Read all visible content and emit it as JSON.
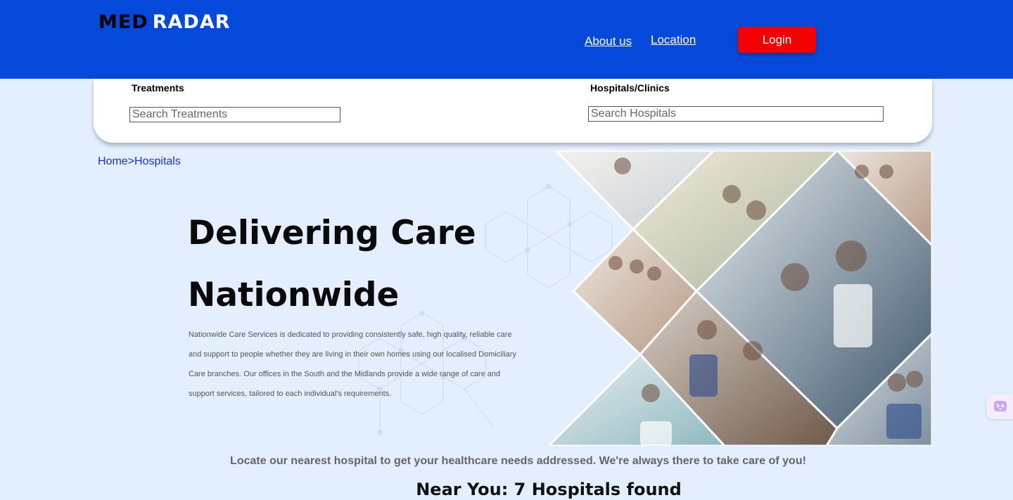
{
  "header": {
    "logo_left": "MED",
    "logo_right": "RADAR",
    "nav": {
      "about": "About us",
      "location": "Location"
    },
    "login_label": "Login"
  },
  "search": {
    "treatments_label": "Treatments",
    "treatments_placeholder": "Search Treatments",
    "hospitals_label": "Hospitals/Clinics",
    "hospitals_placeholder": "Search Hospitals"
  },
  "breadcrumb": {
    "home": "Home",
    "separator": ">",
    "current": "Hospitals"
  },
  "hero": {
    "title_line1": "Delivering Care",
    "title_line2": "Nationwide",
    "description": "Nationwide Care Services is dedicated to providing consistently safe, high quality, reliable care and support to people whether they are living in their own homes using our localised Domiciliary Care branches. Our offices in the South and the Midlands provide a wide range of care and support services, tailored to each individual's requirements."
  },
  "locate_text": "Locate our nearest hospital to get your healthcare needs addressed. We're always there to take care of you!",
  "near_you": "Near You: 7 Hospitals found",
  "colors": {
    "header_bg": "#0449d9",
    "page_bg": "#e3efff",
    "login_bg": "#f50000",
    "breadcrumb": "#1d2ed6"
  },
  "icons": {
    "side_widget": "chat-bot-icon"
  }
}
